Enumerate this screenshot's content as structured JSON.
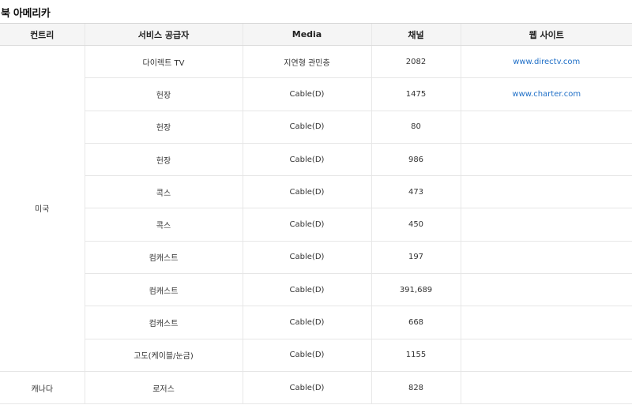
{
  "section_title": "북 아메리카",
  "table": {
    "headers": [
      "컨트리",
      "서비스 공급자",
      "Media",
      "채널",
      "웹 사이트"
    ],
    "rows": [
      {
        "country": "미국",
        "provider": "다이렉트 TV",
        "media": "지연형 관민층",
        "channel": "2082",
        "website": "www.directv.com"
      },
      {
        "country": "",
        "provider": "헌장",
        "media": "Cable(D)",
        "channel": "1475",
        "website": "www.charter.com"
      },
      {
        "country": "",
        "provider": "헌장",
        "media": "Cable(D)",
        "channel": "80",
        "website": ""
      },
      {
        "country": "",
        "provider": "헌장",
        "media": "Cable(D)",
        "channel": "986",
        "website": ""
      },
      {
        "country": "",
        "provider": "콕스",
        "media": "Cable(D)",
        "channel": "473",
        "website": ""
      },
      {
        "country": "",
        "provider": "콕스",
        "media": "Cable(D)",
        "channel": "450",
        "website": ""
      },
      {
        "country": "",
        "provider": "컴캐스트",
        "media": "Cable(D)",
        "channel": "197",
        "website": ""
      },
      {
        "country": "",
        "provider": "컴캐스트",
        "media": "Cable(D)",
        "channel": "391,689",
        "website": ""
      },
      {
        "country": "",
        "provider": "컴캐스트",
        "media": "Cable(D)",
        "channel": "668",
        "website": ""
      },
      {
        "country": "",
        "provider": "고도(케이블/눈금)",
        "media": "Cable(D)",
        "channel": "1155",
        "website": ""
      },
      {
        "country": "캐나다",
        "provider": "로저스",
        "media": "Cable(D)",
        "channel": "828",
        "website": ""
      }
    ]
  }
}
